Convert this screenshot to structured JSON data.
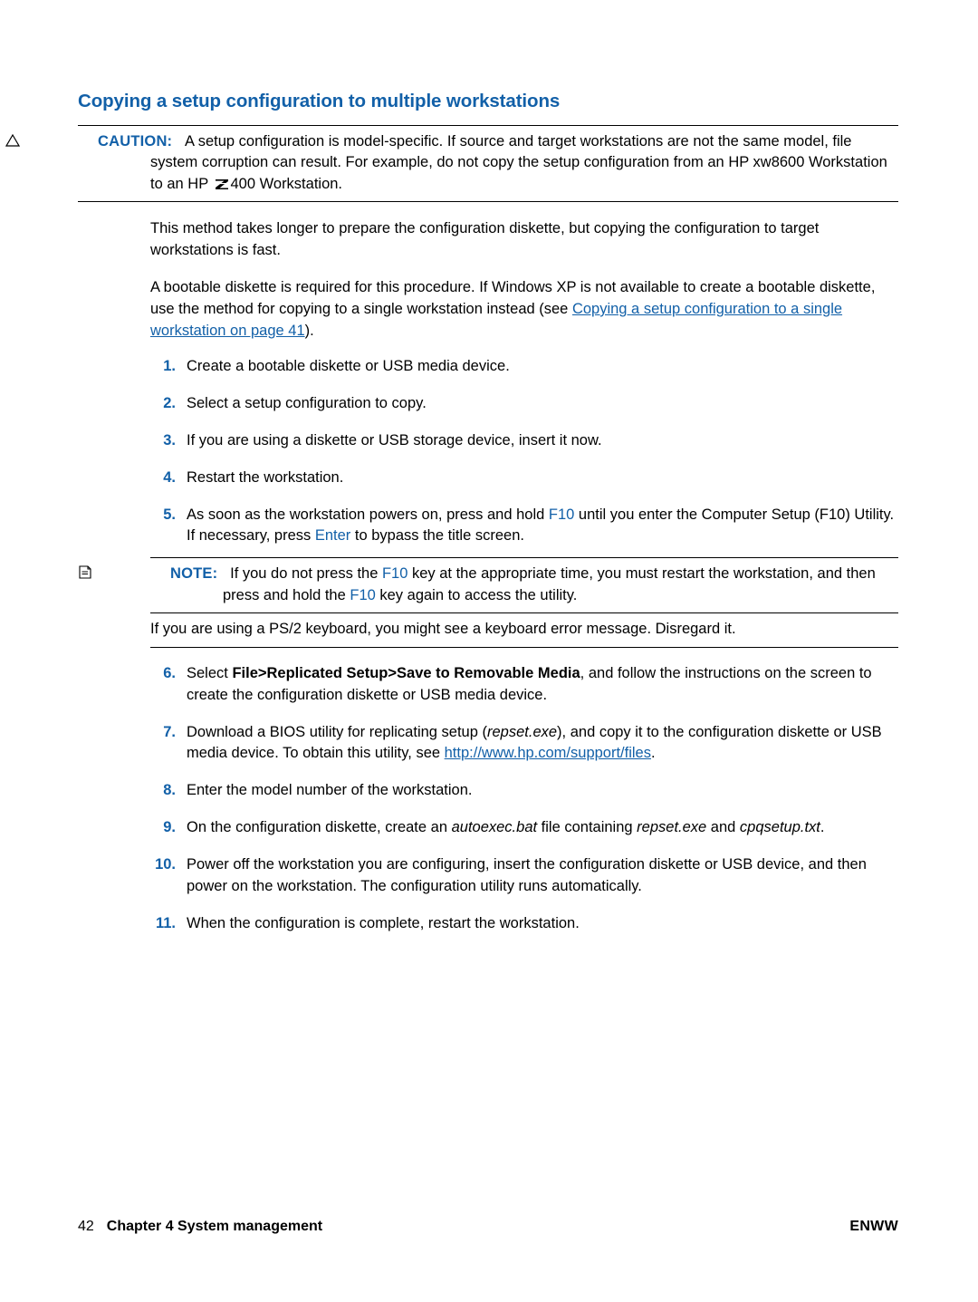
{
  "page": {
    "title": "Copying a setup configuration to multiple workstations",
    "caution": {
      "label": "CAUTION:",
      "text": "A setup configuration is model-specific. If source and target workstations are not the same model, file system corruption can result. For example, do not copy the setup configuration from an HP xw8600 Workstation to an HP ",
      "text_after_logo": "400 Workstation.",
      "icon": "warning-triangle-icon"
    },
    "paragraphs": {
      "p1": "This method takes longer to prepare the configuration diskette, but copying the configuration to target workstations is fast.",
      "p2_before_link": "A bootable diskette is required for this procedure. If Windows XP is not available to create a bootable diskette, use the method for copying to a single workstation instead (see ",
      "p2_link": "Copying a setup configuration to a single workstation on page 41",
      "p2_after_link": ")."
    },
    "steps": [
      {
        "num": "1.",
        "text": "Create a bootable diskette or USB media device."
      },
      {
        "num": "2.",
        "text": "Select a setup configuration to copy."
      },
      {
        "num": "3.",
        "text": "If you are using a diskette or USB storage device, insert it now."
      },
      {
        "num": "4.",
        "text": "Restart the workstation."
      },
      {
        "num": "5.",
        "text": "As soon as the workstation powers on, press and hold "
      },
      {
        "num": "6.",
        "text": "Select "
      },
      {
        "num": "7.",
        "text": "Download a BIOS utility for replicating setup ("
      },
      {
        "num": "8.",
        "text": "Enter the model number of the workstation."
      },
      {
        "num": "9.",
        "text": "On the configuration diskette, create an "
      },
      {
        "num": "10.",
        "text": "Power off the workstation you are configuring, insert the configuration diskette or USB device, and then power on the workstation. The configuration utility runs automatically."
      },
      {
        "num": "11.",
        "text": "When the configuration is complete, restart the workstation."
      }
    ],
    "step5": {
      "part1": "As soon as the workstation powers on, press and hold ",
      "key1": "F10",
      "part2": " until you enter the Computer Setup (F10) Utility. If necessary, press ",
      "key2": "Enter",
      "part3": " to bypass the title screen."
    },
    "note": {
      "label": "NOTE:",
      "part1": "If you do not press the ",
      "key1": "F10",
      "part2": " key at the appropriate time, you must restart the workstation, and then press and hold the ",
      "key2": "F10",
      "part3": " key again to access the utility.",
      "icon": "note-page-icon"
    },
    "note_follow_up": "If you are using a PS/2 keyboard, you might see a keyboard error message. Disregard it.",
    "step6": {
      "part1": "Select ",
      "bold": "File>Replicated Setup>Save to Removable Media",
      "part2": ", and follow the instructions on the screen to create the configuration diskette or USB media device."
    },
    "step7": {
      "part1": "Download a BIOS utility for replicating setup (",
      "ital": "repset.exe",
      "part2": "), and copy it to the configuration diskette or USB media device. To obtain this utility, see ",
      "link": "http://www.hp.com/support/files",
      "part3": "."
    },
    "step9": {
      "part1": "On the configuration diskette, create an ",
      "ital1": "autoexec.bat",
      "part2": " file containing ",
      "ital2": "repset.exe",
      "part3": " and ",
      "ital3": "cpqsetup.txt",
      "part4": "."
    },
    "footer": {
      "page_number": "42",
      "chapter": "Chapter 4   System management",
      "locale": "ENWW"
    },
    "colors": {
      "accent": "#1260a8",
      "text": "#000000"
    }
  }
}
